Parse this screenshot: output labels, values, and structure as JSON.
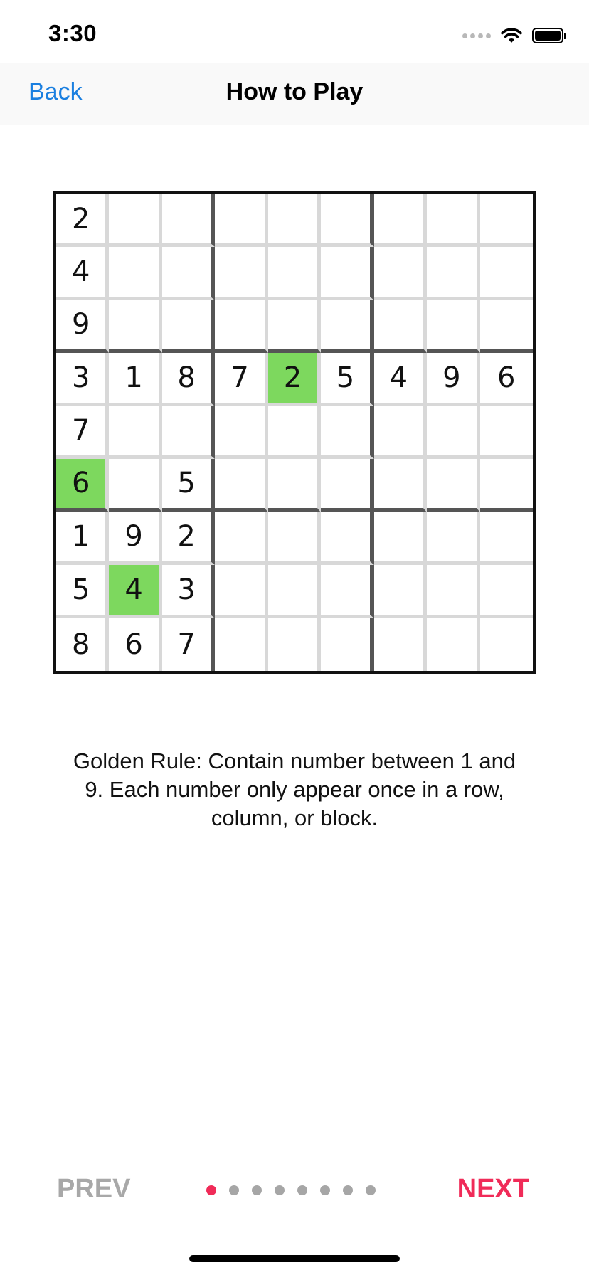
{
  "status_bar": {
    "time": "3:30",
    "icons": [
      "signal-icon",
      "wifi-icon",
      "battery-icon"
    ]
  },
  "nav": {
    "back_label": "Back",
    "title": "How to Play"
  },
  "board": {
    "rows": [
      [
        "2",
        "",
        "",
        "",
        "",
        "",
        "",
        "",
        ""
      ],
      [
        "4",
        "",
        "",
        "",
        "",
        "",
        "",
        "",
        ""
      ],
      [
        "9",
        "",
        "",
        "",
        "",
        "",
        "",
        "",
        ""
      ],
      [
        "3",
        "1",
        "8",
        "7",
        "2",
        "5",
        "4",
        "9",
        "6"
      ],
      [
        "7",
        "",
        "",
        "",
        "",
        "",
        "",
        "",
        ""
      ],
      [
        "6",
        "",
        "5",
        "",
        "",
        "",
        "",
        "",
        ""
      ],
      [
        "1",
        "9",
        "2",
        "",
        "",
        "",
        "",
        "",
        ""
      ],
      [
        "5",
        "4",
        "3",
        "",
        "",
        "",
        "",
        "",
        ""
      ],
      [
        "8",
        "6",
        "7",
        "",
        "",
        "",
        "",
        "",
        ""
      ]
    ],
    "highlighted_cells": [
      [
        3,
        4
      ],
      [
        5,
        0
      ],
      [
        7,
        1
      ]
    ],
    "highlight_color": "#7dd85e"
  },
  "rule_text": "Golden Rule: Contain number between 1 and 9. Each number only appear once in a row, column, or block.",
  "pager": {
    "prev_label": "PREV",
    "next_label": "NEXT",
    "page_count": 8,
    "current_page": 1,
    "accent_color": "#f02b58"
  }
}
